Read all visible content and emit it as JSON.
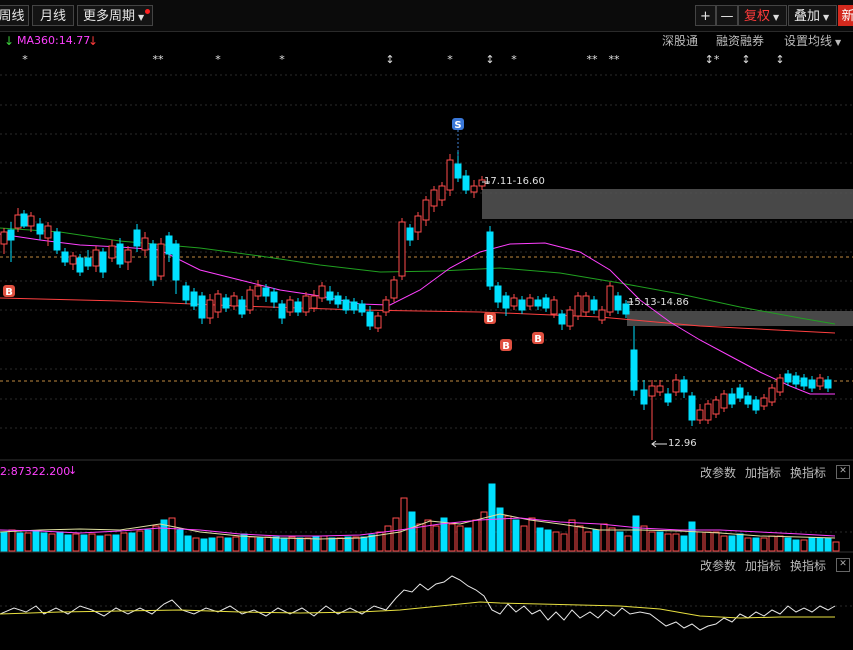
{
  "toolbar": {
    "weekly": "周线",
    "monthly": "月线",
    "more_periods": "更多周期",
    "plus": "+",
    "minus": "—",
    "adjust": "复权",
    "overlay": "叠加",
    "new_partial": "新"
  },
  "ma_indicator": {
    "label": "MA360:14.77"
  },
  "top_links": {
    "shengutong": "深股通",
    "margin": "融资融券",
    "ma_settings": "设置均线"
  },
  "price_annotations": {
    "zone_upper": "17.11-16.60",
    "zone_lower": "15.13-14.86",
    "low_price": "12.96",
    "signal_sell": "S",
    "signal_buy": "B"
  },
  "volume_panel": {
    "label": "2:87322.200",
    "change_params": "改参数",
    "add_indicator": "加指标",
    "switch_indicator": "换指标",
    "close": "✕"
  },
  "indicator_panel": {
    "change_params": "改参数",
    "add_indicator": "加指标",
    "switch_indicator": "换指标",
    "close": "✕"
  },
  "colors": {
    "up": "#ff4d4d",
    "down": "#00e0ff",
    "ma_long": "#ff4040",
    "ma_mid": "#ff40ff",
    "ma_slow": "#20a020"
  }
}
